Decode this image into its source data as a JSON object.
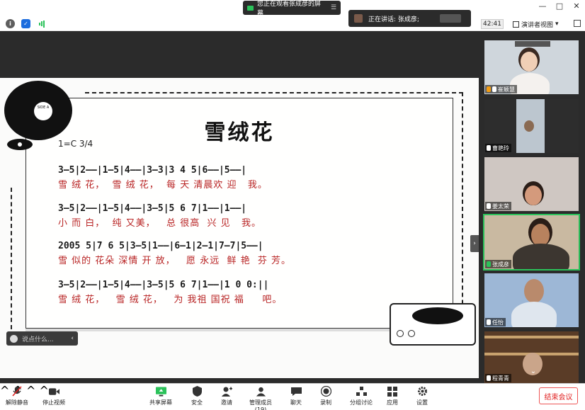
{
  "window": {
    "share_banner": "您正在观看张成彦的屏幕",
    "banner_menu": "☰",
    "controls": [
      "—",
      "□",
      "✕"
    ]
  },
  "topbar": {
    "timer": "42:41",
    "view_label": "演讲者视图",
    "view_caret": "▾"
  },
  "speaker_toast": {
    "text": "正在讲话: 张成彦;"
  },
  "document": {
    "record_label": "SIDE A",
    "title": "雪绒花",
    "key": "1=C  3/4",
    "lines": [
      {
        "notes": "3—5|2——|1—5|4——|3—3|3 4 5|6——|5——|",
        "lyrics": "雪 绒 花，  雪 绒 花，  每 天 清晨欢 迎   我。"
      },
      {
        "notes": "3—5|2——|1—5|4——|3—5|5 6 7|1——|1——|",
        "lyrics": "小 而 白，  纯 又美，   总 很高  兴 见   我。"
      },
      {
        "notes": "2005 5|7 6 5|3—5|1——|6—1|2—1|7—7|5——|",
        "lyrics": "雪 似的 花朵 深情 开 放，   愿 永远  鲜 艳  芬 芳。"
      },
      {
        "notes": "3—5|2——|1—5|4——|3—5|5 6 7|1——|1 0 0:||",
        "lyrics": "雪 绒 花，   雪 绒 花，   为 我祖 国祝 福     吧。"
      }
    ]
  },
  "chat_hint": {
    "placeholder": "说点什么...",
    "chevron": "‹"
  },
  "collapse": "›",
  "participants": [
    {
      "name": "崔颖慧"
    },
    {
      "name": "曹艳玲"
    },
    {
      "name": "姜太荣"
    },
    {
      "name": "张成彦"
    },
    {
      "name": "任怡"
    },
    {
      "name": "程青青"
    }
  ],
  "scroll_down": "⌄",
  "bottombar": {
    "unmute": "解除静音",
    "start_video": "停止视频",
    "share": "共享屏幕",
    "security": "安全",
    "invite": "邀请",
    "participants": "管理成员(19)",
    "chat": "聊天",
    "record": "录制",
    "breakout": "分组讨论",
    "apps": "应用",
    "settings": "设置",
    "end": "结束会议"
  },
  "colors": {
    "accent_green": "#2bc25a",
    "lyric_red": "#b82323",
    "end_red": "#e02020"
  }
}
